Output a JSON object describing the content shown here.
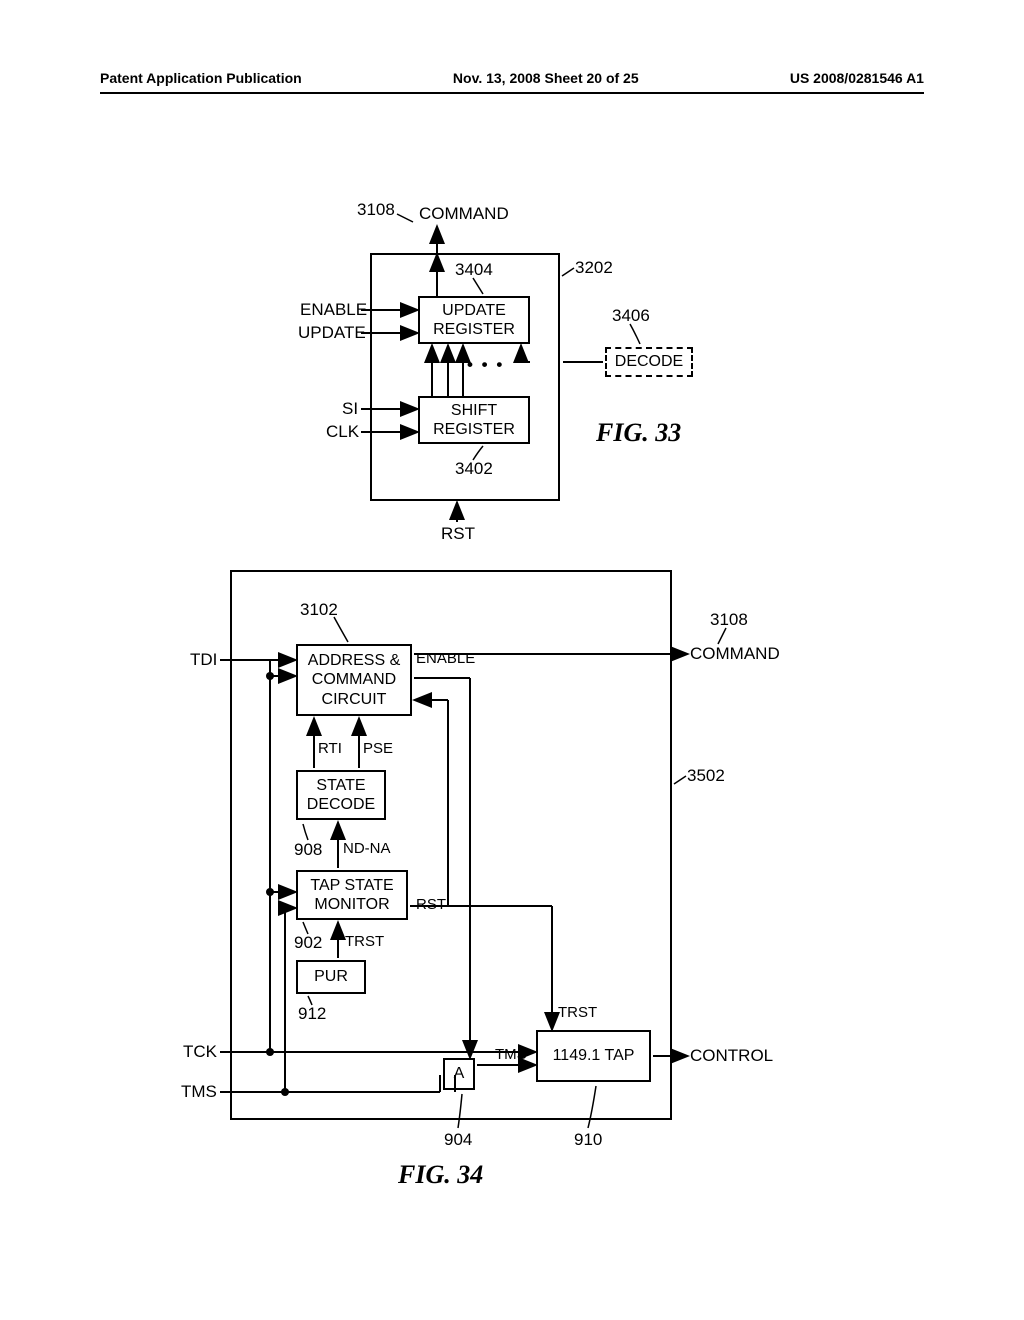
{
  "header": {
    "left": "Patent Application Publication",
    "center": "Nov. 13, 2008  Sheet 20 of 25",
    "right": "US 2008/0281546 A1"
  },
  "fig33": {
    "label": "FIG. 33",
    "ref_command": "3108",
    "ref_main": "3202",
    "ref_update": "3404",
    "ref_decode": "3406",
    "ref_shift": "3402",
    "sig_command": "COMMAND",
    "sig_enable": "ENABLE",
    "sig_update": "UPDATE",
    "sig_si": "SI",
    "sig_clk": "CLK",
    "sig_rst": "RST",
    "blk_update1": "UPDATE",
    "blk_update2": "REGISTER",
    "blk_shift1": "SHIFT",
    "blk_shift2": "REGISTER",
    "blk_decode": "DECODE",
    "dots": "• • •"
  },
  "fig34": {
    "label": "FIG. 34",
    "ref_3102": "3102",
    "ref_3108": "3108",
    "ref_3502": "3502",
    "ref_908": "908",
    "ref_902": "902",
    "ref_912": "912",
    "ref_904": "904",
    "ref_910": "910",
    "sig_tdi": "TDI",
    "sig_tck": "TCK",
    "sig_tms": "TMS",
    "sig_command": "COMMAND",
    "sig_control": "CONTROL",
    "sig_enable": "ENABLE",
    "sig_rti": "RTI",
    "sig_pse": "PSE",
    "sig_ndna": "ND-NA",
    "sig_rst": "RST",
    "sig_trst1": "TRST",
    "sig_trst2": "TRST",
    "sig_tmsp": "TMS'",
    "blk_addr1": "ADDRESS &",
    "blk_addr2": "COMMAND",
    "blk_addr3": "CIRCUIT",
    "blk_state1": "STATE",
    "blk_state2": "DECODE",
    "blk_tap1": "TAP STATE",
    "blk_tap2": "MONITOR",
    "blk_pur": "PUR",
    "blk_a": "A",
    "blk_1149": "1149.1 TAP"
  }
}
